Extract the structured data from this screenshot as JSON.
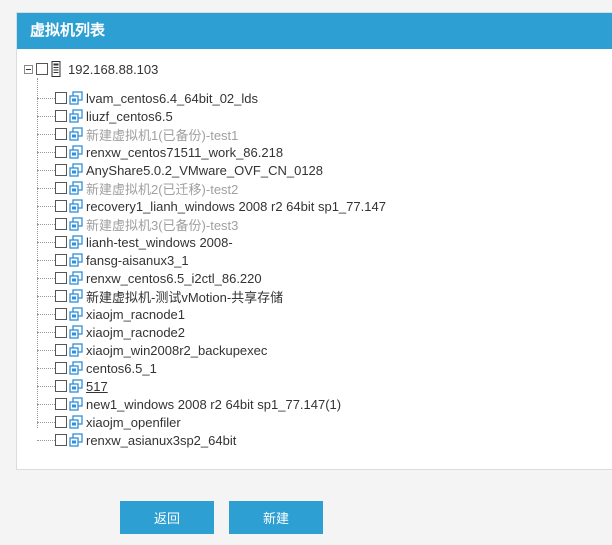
{
  "panel": {
    "title": "虚拟机列表"
  },
  "tree": {
    "root": {
      "label": "192.168.88.103",
      "icon": "server-icon"
    },
    "items": [
      {
        "label": "lvam_centos6.4_64bit_02_lds",
        "style": "normal"
      },
      {
        "label": "liuzf_centos6.5",
        "style": "normal"
      },
      {
        "label": "新建虚拟机1(已备份)-test1",
        "style": "gray"
      },
      {
        "label": "renxw_centos71511_work_86.218",
        "style": "normal"
      },
      {
        "label": "AnyShare5.0.2_VMware_OVF_CN_0128",
        "style": "normal"
      },
      {
        "label": "新建虚拟机2(已迁移)-test2",
        "style": "gray"
      },
      {
        "label": "recovery1_lianh_windows 2008 r2 64bit sp1_77.147",
        "style": "normal"
      },
      {
        "label": "新建虚拟机3(已备份)-test3",
        "style": "gray"
      },
      {
        "label": "lianh-test_windows 2008-",
        "style": "normal"
      },
      {
        "label": "fansg-aisanux3_1",
        "style": "normal"
      },
      {
        "label": "renxw_centos6.5_i2ctl_86.220",
        "style": "normal"
      },
      {
        "label": "新建虚拟机-测试vMotion-共享存储",
        "style": "normal"
      },
      {
        "label": "xiaojm_racnode1",
        "style": "normal"
      },
      {
        "label": "xiaojm_racnode2",
        "style": "normal"
      },
      {
        "label": "xiaojm_win2008r2_backupexec",
        "style": "normal"
      },
      {
        "label": "centos6.5_1",
        "style": "normal"
      },
      {
        "label": "517",
        "style": "link"
      },
      {
        "label": "new1_windows 2008 r2 64bit sp1_77.147(1)",
        "style": "normal"
      },
      {
        "label": "xiaojm_openfiler",
        "style": "normal"
      },
      {
        "label": "renxw_asianux3sp2_64bit",
        "style": "normal"
      }
    ]
  },
  "buttons": {
    "back": "返回",
    "create": "新建"
  },
  "colors": {
    "accent": "#2e9fd3",
    "vm_icon": "#2f8fd8"
  }
}
